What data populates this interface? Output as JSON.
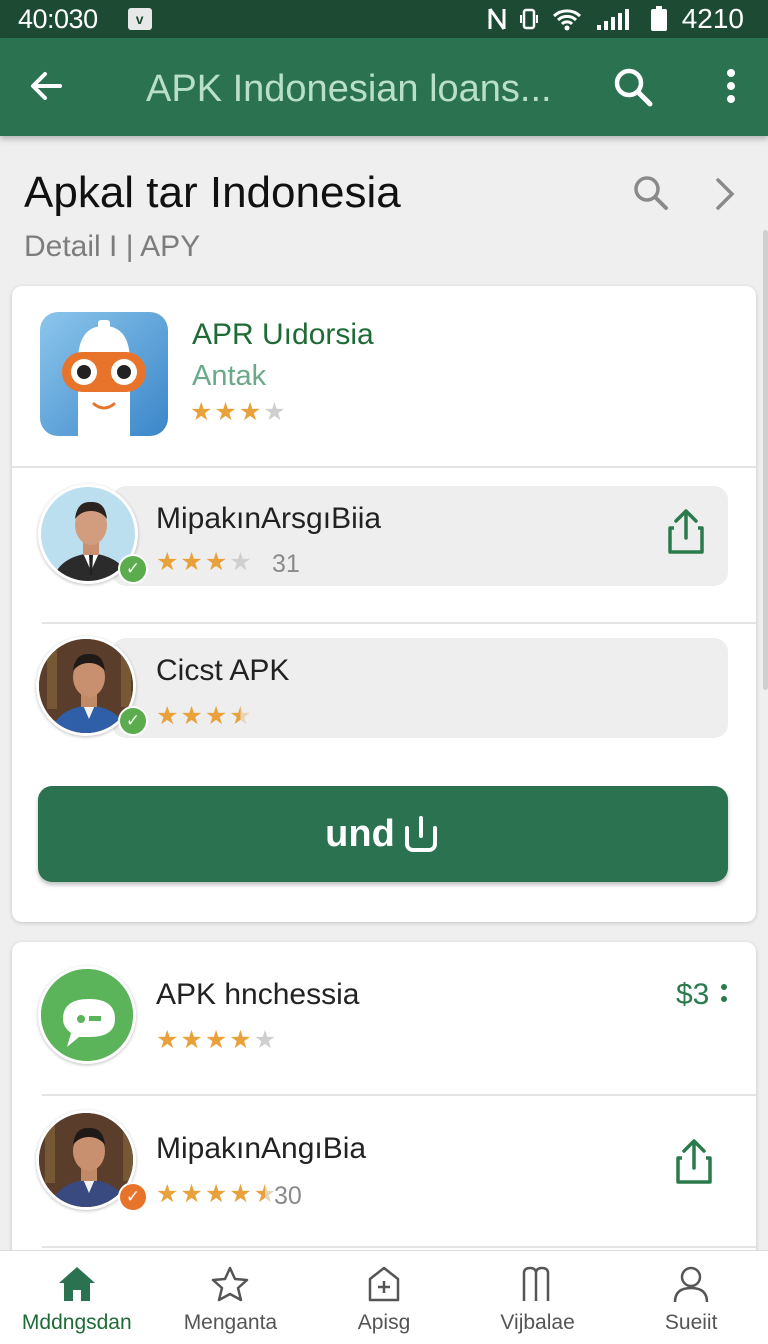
{
  "status_bar": {
    "time": "40:030",
    "notification": "v",
    "battery": "4210"
  },
  "app_bar": {
    "title": "APK Indonesian loans..."
  },
  "header": {
    "title": "Apkal tar Indonesia",
    "subtitle": "Detail I | APY"
  },
  "featured": {
    "app_name": "APR Uıdorsia",
    "developer": "Antak",
    "rating": 3,
    "rows": [
      {
        "name": "MipakınArsgıBiia",
        "rating": 3,
        "count": "31"
      },
      {
        "name": "Cicst APK",
        "rating": 3.5
      }
    ],
    "install_label": "und"
  },
  "list": [
    {
      "name": "APK hnchessia",
      "rating": 4.5,
      "price": "$3"
    },
    {
      "name": "MipakınAngıBia",
      "rating": 4.5,
      "count": "30"
    }
  ],
  "bottom_nav": [
    {
      "label": "Mddngsdan",
      "icon": "home-icon"
    },
    {
      "label": "Menganta",
      "icon": "star-icon"
    },
    {
      "label": "Apisg",
      "icon": "bag-icon"
    },
    {
      "label": "Vijbalae",
      "icon": "library-icon"
    },
    {
      "label": "Sueiit",
      "icon": "person-icon"
    }
  ],
  "colors": {
    "primary": "#2a7250",
    "status_bar": "#1c4a33",
    "star": "#e9a13b",
    "verified": "#5aac4c",
    "badge_orange": "#e8742b"
  }
}
